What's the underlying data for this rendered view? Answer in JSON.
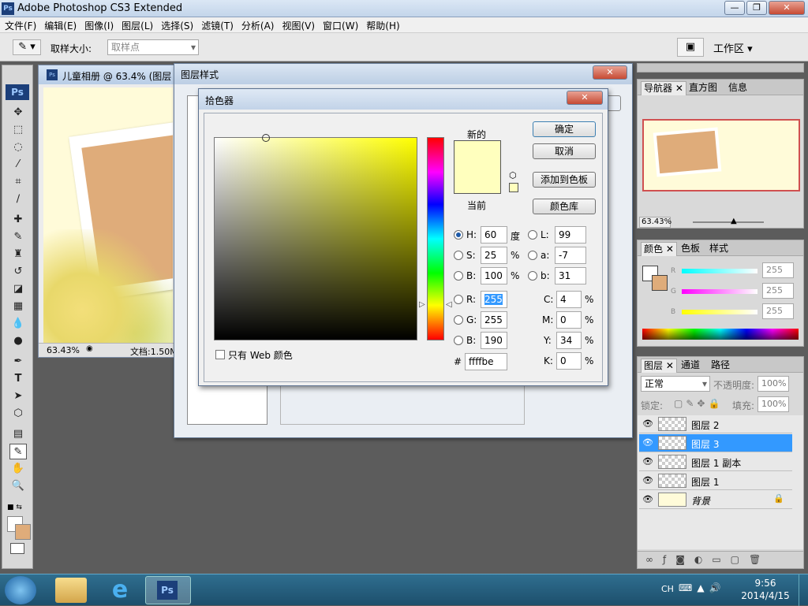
{
  "app": {
    "title": "Adobe Photoshop CS3 Extended",
    "logo": "Ps"
  },
  "menu": [
    "文件(F)",
    "编辑(E)",
    "图像(I)",
    "图层(L)",
    "选择(S)",
    "滤镜(T)",
    "分析(A)",
    "视图(V)",
    "窗口(W)",
    "帮助(H)"
  ],
  "options": {
    "sample_size_label": "取样大小:",
    "sample_size_value": "取样点",
    "workspace": "工作区 ▾"
  },
  "document": {
    "title": "儿童相册 @ 63.4% (图层 ",
    "zoom": "63.43%",
    "doc_info": "文档:1.50M"
  },
  "layer_style": {
    "title": "图层样式"
  },
  "color_picker": {
    "title": "拾色器",
    "new_label": "新的",
    "current_label": "当前",
    "ok": "确定",
    "cancel": "取消",
    "add_swatch": "添加到色板",
    "color_libs": "颜色库",
    "web_only": "只有 Web 颜色",
    "hex_label": "#",
    "hex": "ffffbe",
    "new_color": "#ffffbe",
    "current_color": "#ffffbe",
    "hsb": {
      "H": "60",
      "S": "25",
      "B": "100",
      "H_unit": "度",
      "pct": "%"
    },
    "rgb": {
      "R": "255",
      "G": "255",
      "B": "190"
    },
    "lab": {
      "L": "99",
      "a": "-7",
      "b": "31"
    },
    "cmyk": {
      "C": "4",
      "M": "0",
      "Y": "34",
      "K": "0"
    }
  },
  "navigator": {
    "tabs": [
      "导航器",
      "直方图",
      "信息"
    ],
    "zoom": "63.43%"
  },
  "color_panel": {
    "tabs": [
      "颜色",
      "色板",
      "样式"
    ],
    "R": "255",
    "G": "255",
    "B": "255"
  },
  "layers": {
    "tabs": [
      "图层",
      "通道",
      "路径"
    ],
    "blend_mode": "正常",
    "opacity_label": "不透明度:",
    "opacity": "100%",
    "lock_label": "锁定:",
    "fill_label": "填充:",
    "fill": "100%",
    "items": [
      {
        "name": "图层 2",
        "selected": false
      },
      {
        "name": "图层 3",
        "selected": true
      },
      {
        "name": "图层 1 副本",
        "selected": false
      },
      {
        "name": "图层 1",
        "selected": false
      },
      {
        "name": "背景",
        "selected": false
      }
    ]
  },
  "taskbar": {
    "lang": "CH",
    "time": "9:56",
    "date": "2014/4/15"
  }
}
